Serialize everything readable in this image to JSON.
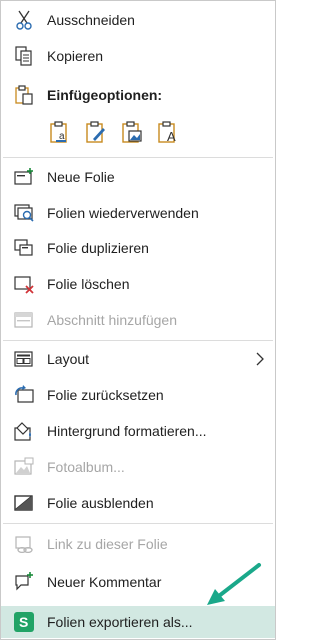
{
  "menu": {
    "items": [
      {
        "id": "cut",
        "label": "Ausschneiden",
        "icon": "scissors-icon",
        "enabled": true
      },
      {
        "id": "copy",
        "label": "Kopieren",
        "icon": "copy-icon",
        "enabled": true
      },
      {
        "id": "paste-options",
        "label": "Einfügeoptionen:",
        "icon": "clipboard-icon",
        "enabled": true
      },
      {
        "id": "new-slide",
        "label": "Neue Folie",
        "icon": "new-slide-icon",
        "enabled": true
      },
      {
        "id": "reuse-slides",
        "label": "Folien wiederverwenden",
        "icon": "reuse-slides-icon",
        "enabled": true
      },
      {
        "id": "duplicate-slide",
        "label": "Folie duplizieren",
        "icon": "duplicate-slide-icon",
        "enabled": true
      },
      {
        "id": "delete-slide",
        "label": "Folie löschen",
        "icon": "delete-slide-icon",
        "enabled": true
      },
      {
        "id": "add-section",
        "label": "Abschnitt hinzufügen",
        "icon": "section-icon",
        "enabled": false
      },
      {
        "id": "layout",
        "label": "Layout",
        "icon": "layout-icon",
        "enabled": true,
        "submenu": true
      },
      {
        "id": "reset-slide",
        "label": "Folie zurücksetzen",
        "icon": "reset-slide-icon",
        "enabled": true
      },
      {
        "id": "format-background",
        "label": "Hintergrund formatieren...",
        "icon": "format-background-icon",
        "enabled": true
      },
      {
        "id": "photo-album",
        "label": "Fotoalbum...",
        "icon": "photo-album-icon",
        "enabled": false
      },
      {
        "id": "hide-slide",
        "label": "Folie ausblenden",
        "icon": "hide-slide-icon",
        "enabled": true
      },
      {
        "id": "link-to-slide",
        "label": "Link zu dieser Folie",
        "icon": "link-icon",
        "enabled": false
      },
      {
        "id": "new-comment",
        "label": "Neuer Kommentar",
        "icon": "comment-icon",
        "enabled": true
      },
      {
        "id": "export-slides",
        "label": "Folien exportieren als...",
        "icon": "export-s-icon",
        "enabled": true,
        "selected": true
      }
    ],
    "paste_buttons": [
      {
        "name": "paste-use-destination-theme-icon",
        "letter": "a"
      },
      {
        "name": "paste-keep-source-formatting-icon",
        "letter": ""
      },
      {
        "name": "paste-picture-icon",
        "letter": ""
      },
      {
        "name": "paste-keep-text-only-icon",
        "letter": "A"
      }
    ],
    "selected_highlight_color": "#d2e8e2",
    "annotation_arrow_color": "#1aa88a",
    "export_icon_color": "#21a366"
  }
}
